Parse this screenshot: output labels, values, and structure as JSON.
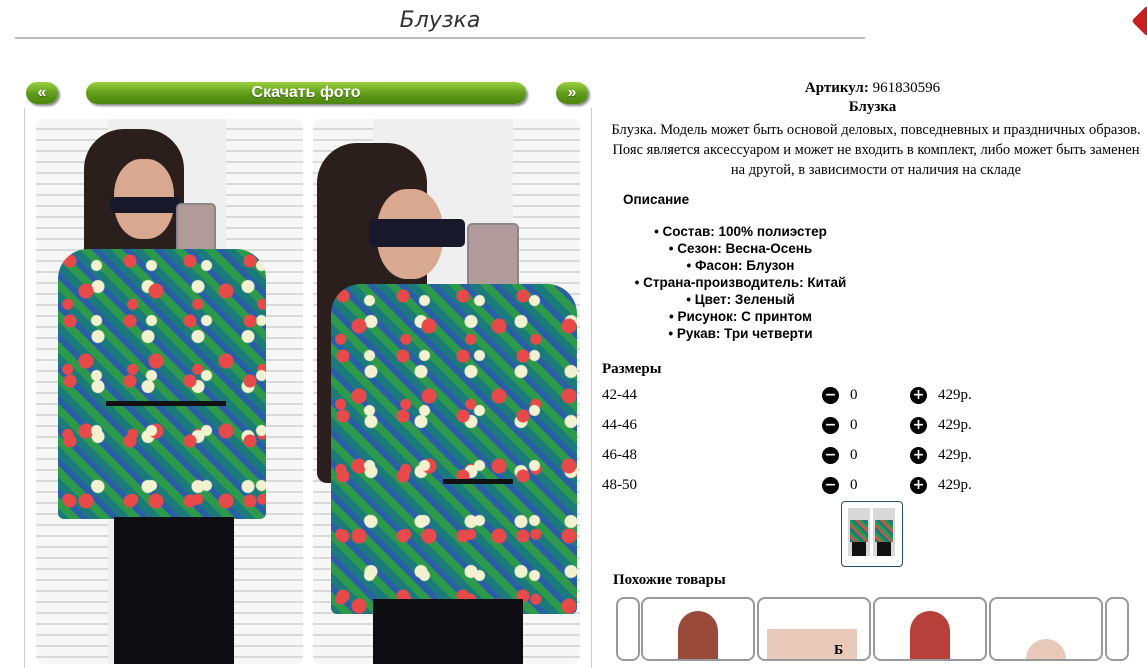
{
  "page": {
    "title": "Блузка"
  },
  "gallery": {
    "prev_label": "«",
    "download_label": "Скачать фото",
    "next_label": "»"
  },
  "product": {
    "article_label": "Артикул:",
    "article_value": "961830596",
    "name": "Блузка",
    "description": "Блузка. Модель может быть основой деловых, повседневных и праздничных образов. Пояс является аксессуаром и может не входить в комплект, либо может быть заменен на другой, в зависимости от наличия на складе",
    "description_heading": "Описание",
    "specs": [
      "Состав: 100% полиэстер",
      "Сезон: Весна-Осень",
      "Фасон: Блузон",
      "Страна-производитель: Китай",
      "Цвет: Зеленый",
      "Рисунок: С принтом",
      "Рукав: Три четверти"
    ]
  },
  "sizes": {
    "heading": "Размеры",
    "minus_icon": "minus-circle-icon",
    "plus_icon": "plus-circle-icon",
    "rows": [
      {
        "label": "42-44",
        "qty": "0",
        "price": "429р."
      },
      {
        "label": "44-46",
        "qty": "0",
        "price": "429р."
      },
      {
        "label": "46-48",
        "qty": "0",
        "price": "429р."
      },
      {
        "label": "48-50",
        "qty": "0",
        "price": "429р."
      }
    ]
  },
  "similar": {
    "heading": "Похожие товары",
    "partial_caption": "Б"
  },
  "colors": {
    "button_green": "#5e9a18",
    "shirt_teal": "#1b7a7a",
    "accent_red": "#c81e1e"
  }
}
